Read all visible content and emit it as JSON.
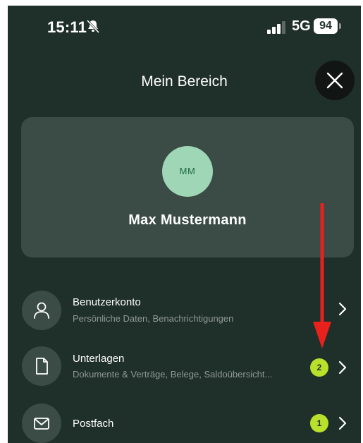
{
  "status_bar": {
    "time": "15:11",
    "network": "5G",
    "battery": "94"
  },
  "header": {
    "title": "Mein Bereich"
  },
  "profile": {
    "initials": "MM",
    "name": "Max Mustermann"
  },
  "menu": [
    {
      "icon": "user-icon",
      "title": "Benutzerkonto",
      "subtitle": "Persönliche Daten, Benachrichtigungen",
      "badge": ""
    },
    {
      "icon": "document-icon",
      "title": "Unterlagen",
      "subtitle": "Dokumente & Verträge, Belege, Saldoübersicht...",
      "badge": "2"
    },
    {
      "icon": "mail-icon",
      "title": "Postfach",
      "subtitle": "",
      "badge": "1"
    }
  ],
  "colors": {
    "background": "#1f2f29",
    "card": "#3a4c45",
    "badge": "#b9e02a",
    "avatar": "#9fd6b5",
    "annotation_arrow": "#e8211d"
  }
}
